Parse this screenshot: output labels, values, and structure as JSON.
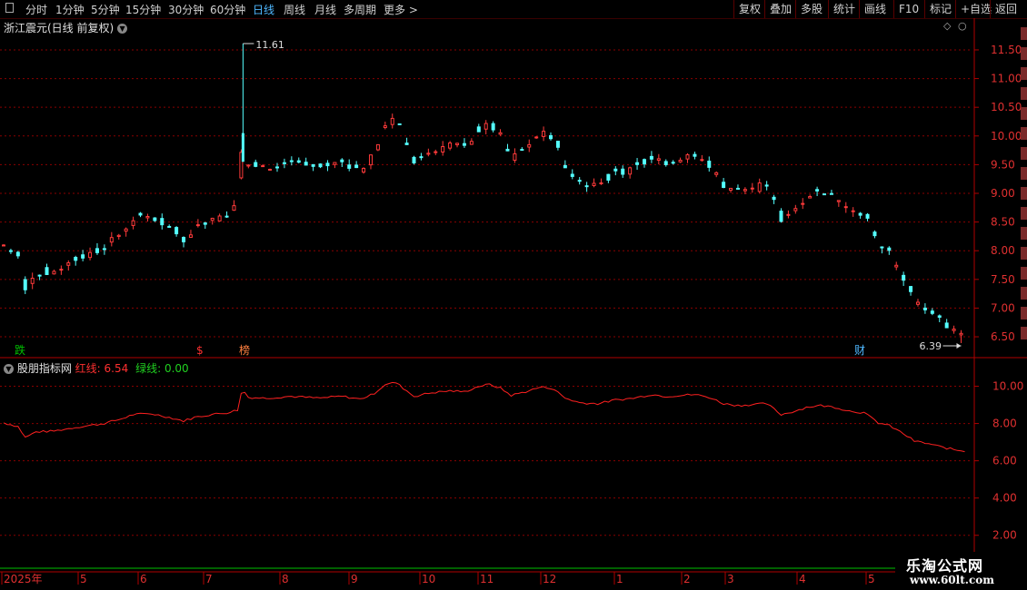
{
  "toolbar": {
    "periods": [
      {
        "label": "分时",
        "active": false
      },
      {
        "label": "1分钟",
        "active": false
      },
      {
        "label": "5分钟",
        "active": false
      },
      {
        "label": "15分钟",
        "active": false
      },
      {
        "label": "30分钟",
        "active": false
      },
      {
        "label": "60分钟",
        "active": false
      },
      {
        "label": "日线",
        "active": true
      },
      {
        "label": "周线",
        "active": false
      },
      {
        "label": "月线",
        "active": false
      },
      {
        "label": "多周期",
        "active": false
      },
      {
        "label": "更多",
        "active": false
      }
    ],
    "right_buttons": [
      "复权",
      "叠加",
      "多股",
      "统计",
      "画线",
      "F10",
      "标记",
      "+自选",
      "返回"
    ]
  },
  "main_chart": {
    "title": "浙江震元(日线 前复权)",
    "high_label": "11.61",
    "low_label": "6.39",
    "y_ticks": [
      "11.50",
      "11.00",
      "10.50",
      "10.00",
      "9.50",
      "9.00",
      "8.50",
      "8.00",
      "7.50",
      "7.00",
      "6.50"
    ],
    "event_markers": [
      {
        "text": "跌",
        "color": "#00c000"
      },
      {
        "text": "$",
        "color": "#ff3030"
      },
      {
        "text": "榜",
        "color": "#ff8040"
      },
      {
        "text": "财",
        "color": "#4fb8ff"
      }
    ]
  },
  "indicator": {
    "name": "股朋指标网",
    "red_label": "红线:",
    "red_value": "6.54",
    "green_label": "绿线:",
    "green_value": "0.00",
    "y_ticks": [
      "10.00",
      "8.00",
      "6.00",
      "4.00",
      "2.00"
    ]
  },
  "time_axis": {
    "labels": [
      "2025年",
      "5",
      "6",
      "7",
      "8",
      "9",
      "10",
      "11",
      "12",
      "1",
      "2",
      "3",
      "4",
      "5"
    ]
  },
  "watermark": {
    "line1": "乐淘公式网",
    "line2": "www.60lt.com"
  },
  "chart_data": {
    "type": "candlestick",
    "instrument": "浙江震元",
    "period": "日线",
    "adjustment": "前复权",
    "price_range": [
      6.2,
      11.8
    ],
    "indicator_range": [
      1.5,
      11.0
    ],
    "high": 11.61,
    "low": 6.39,
    "anchors": [
      [
        0,
        8.1
      ],
      [
        8,
        7.9
      ],
      [
        12,
        7.3
      ],
      [
        18,
        7.6
      ],
      [
        28,
        7.65
      ],
      [
        40,
        7.85
      ],
      [
        55,
        8.05
      ],
      [
        65,
        8.3
      ],
      [
        72,
        8.55
      ],
      [
        82,
        8.6
      ],
      [
        92,
        8.4
      ],
      [
        100,
        8.2
      ],
      [
        106,
        8.4
      ],
      [
        115,
        8.55
      ],
      [
        124,
        8.65
      ],
      [
        130,
        8.8
      ],
      [
        131,
        9.35
      ],
      [
        133,
        10.05
      ],
      [
        135,
        9.5
      ],
      [
        145,
        9.45
      ],
      [
        160,
        9.55
      ],
      [
        175,
        9.45
      ],
      [
        188,
        9.55
      ],
      [
        198,
        9.4
      ],
      [
        205,
        9.65
      ],
      [
        212,
        10.2
      ],
      [
        218,
        10.3
      ],
      [
        222,
        10.0
      ],
      [
        228,
        9.55
      ],
      [
        238,
        9.75
      ],
      [
        248,
        9.85
      ],
      [
        256,
        9.8
      ],
      [
        264,
        10.1
      ],
      [
        270,
        10.2
      ],
      [
        276,
        10.0
      ],
      [
        282,
        9.6
      ],
      [
        290,
        9.8
      ],
      [
        298,
        10.05
      ],
      [
        305,
        10.0
      ],
      [
        312,
        9.45
      ],
      [
        320,
        9.2
      ],
      [
        330,
        9.15
      ],
      [
        340,
        9.35
      ],
      [
        350,
        9.45
      ],
      [
        360,
        9.65
      ],
      [
        368,
        9.55
      ],
      [
        376,
        9.6
      ],
      [
        384,
        9.65
      ],
      [
        392,
        9.5
      ],
      [
        400,
        9.15
      ],
      [
        408,
        9.05
      ],
      [
        416,
        9.1
      ],
      [
        424,
        9.15
      ],
      [
        428,
        8.85
      ],
      [
        432,
        8.55
      ],
      [
        440,
        8.75
      ],
      [
        446,
        8.95
      ],
      [
        454,
        9.05
      ],
      [
        462,
        8.95
      ],
      [
        470,
        8.75
      ],
      [
        478,
        8.65
      ],
      [
        486,
        8.1
      ],
      [
        492,
        7.95
      ],
      [
        500,
        7.5
      ],
      [
        506,
        7.1
      ],
      [
        514,
        6.95
      ],
      [
        522,
        6.75
      ],
      [
        530,
        6.6
      ],
      [
        535,
        6.54
      ]
    ],
    "indicator_series": {
      "name": "红线",
      "last": 6.54
    },
    "green_series": {
      "name": "绿线",
      "last": 0.0
    }
  }
}
